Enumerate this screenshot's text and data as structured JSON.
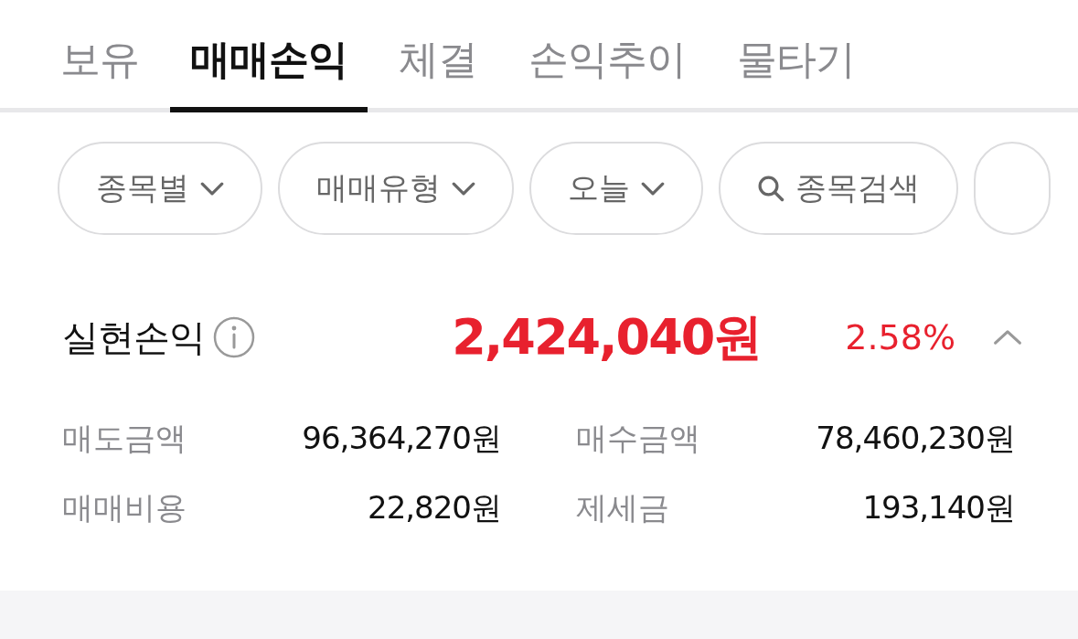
{
  "tabs": [
    {
      "label": "보유",
      "selected": false
    },
    {
      "label": "매매손익",
      "selected": true
    },
    {
      "label": "체결",
      "selected": false
    },
    {
      "label": "손익추이",
      "selected": false
    },
    {
      "label": "물타기",
      "selected": false
    }
  ],
  "filters": [
    {
      "kind": "dropdown",
      "label": "종목별"
    },
    {
      "kind": "dropdown",
      "label": "매매유형"
    },
    {
      "kind": "dropdown",
      "label": "오늘"
    },
    {
      "kind": "search",
      "label": "종목검색"
    }
  ],
  "summary": {
    "title": "실현손익",
    "amount": "2,424,040원",
    "rate": "2.58%",
    "expanded": true
  },
  "details": [
    {
      "label": "매도금액",
      "value": "96,364,270원"
    },
    {
      "label": "매수금액",
      "value": "78,460,230원"
    },
    {
      "label": "매매비용",
      "value": "22,820원"
    },
    {
      "label": "제세금",
      "value": "193,140원"
    }
  ]
}
